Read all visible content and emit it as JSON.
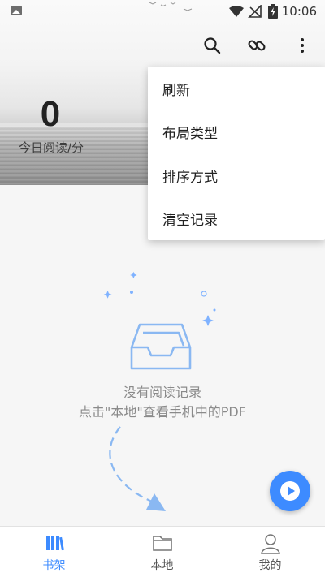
{
  "status_bar": {
    "time": "10:06",
    "icons": [
      "image-icon",
      "wifi-icon",
      "no-signal-icon",
      "battery-charging-icon"
    ]
  },
  "toolbar": {
    "icons": [
      "search-icon",
      "link-icon",
      "more-vert-icon"
    ]
  },
  "reading_stats": {
    "count": "0",
    "label": "今日阅读/分"
  },
  "menu": {
    "items": [
      {
        "label": "刷新"
      },
      {
        "label": "布局类型"
      },
      {
        "label": "排序方式"
      },
      {
        "label": "清空记录"
      }
    ]
  },
  "empty_state": {
    "title": "没有阅读记录",
    "hint": "点击\"本地\"查看手机中的PDF",
    "icon": "inbox-icon"
  },
  "fab": {
    "icon": "play-icon",
    "color": "#3d8bff"
  },
  "bottom_nav": {
    "items": [
      {
        "label": "书架",
        "icon": "bookshelf-icon",
        "active": true
      },
      {
        "label": "本地",
        "icon": "folder-icon",
        "active": false
      },
      {
        "label": "我的",
        "icon": "person-icon",
        "active": false
      }
    ]
  },
  "colors": {
    "accent": "#3d8bff",
    "text_primary": "#222222",
    "text_secondary": "#8a8a8a"
  }
}
